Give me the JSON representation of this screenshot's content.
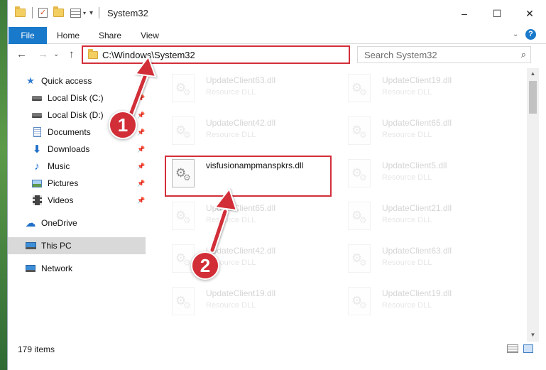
{
  "window": {
    "title": "System32",
    "controls": {
      "minimize": "–",
      "maximize": "☐",
      "close": "✕"
    }
  },
  "ribbon": {
    "tabs": [
      {
        "label": "File",
        "active": true
      },
      {
        "label": "Home"
      },
      {
        "label": "Share"
      },
      {
        "label": "View"
      }
    ]
  },
  "address_bar": {
    "path": "C:\\Windows\\System32",
    "search_placeholder": "Search System32"
  },
  "nav_pane": {
    "items": [
      {
        "label": "Quick access",
        "icon": "star-icon"
      },
      {
        "label": "Local Disk (C:)",
        "icon": "drive-icon",
        "pinned": true
      },
      {
        "label": "Local Disk (D:)",
        "icon": "drive-icon",
        "pinned": true
      },
      {
        "label": "Documents",
        "icon": "documents-icon",
        "pinned": true
      },
      {
        "label": "Downloads",
        "icon": "download-icon",
        "pinned": true
      },
      {
        "label": "Music",
        "icon": "music-icon",
        "pinned": true
      },
      {
        "label": "Pictures",
        "icon": "pictures-icon",
        "pinned": true
      },
      {
        "label": "Videos",
        "icon": "video-icon",
        "pinned": true
      },
      {
        "label": "OneDrive",
        "icon": "cloud-icon"
      },
      {
        "label": "This PC",
        "icon": "computer-icon",
        "selected": true
      },
      {
        "label": "Network",
        "icon": "network-icon"
      }
    ]
  },
  "files": [
    {
      "name": "UpdateClient63.dll",
      "type": "Resource DLL"
    },
    {
      "name": "UpdateClient19.dll",
      "type": "Resource DLL"
    },
    {
      "name": "UpdateClient42.dll",
      "type": "Resource DLL"
    },
    {
      "name": "UpdateClient65.dll",
      "type": "Resource DLL"
    },
    {
      "name": "visfusionampmanspkrs.dll",
      "type": "",
      "highlighted": true
    },
    {
      "name": "UpdateClient5.dll",
      "type": "Resource DLL"
    },
    {
      "name": "UpdateClient65.dll",
      "type": "Resource DLL"
    },
    {
      "name": "UpdateClient21.dll",
      "type": "Resource DLL"
    },
    {
      "name": "UpdateClient42.dll",
      "type": "Resource DLL"
    },
    {
      "name": "UpdateClient63.dll",
      "type": "Resource DLL"
    },
    {
      "name": "UpdateClient19.dll",
      "type": "Resource DLL"
    },
    {
      "name": "UpdateClient19.dll",
      "type": "Resource DLL"
    }
  ],
  "status_bar": {
    "item_count": "179 items"
  },
  "annotations": {
    "step1": "1",
    "step2": "2",
    "highlight_color": "#d32f3a"
  }
}
